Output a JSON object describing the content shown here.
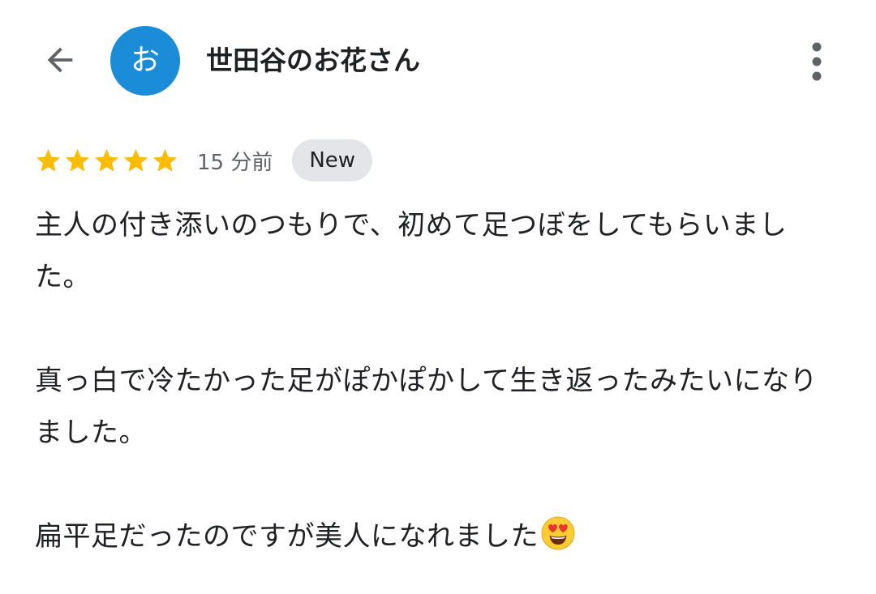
{
  "header": {
    "user_name": "世田谷のお花さん",
    "avatar_letter": "お",
    "avatar_color": "#1a8cd8",
    "back_icon": "arrow-back-icon",
    "more_icon": "more-vert-icon"
  },
  "review": {
    "rating": 5,
    "rating_max": 5,
    "star_color": "#fbbc04",
    "time_ago": "15 分前",
    "badge": "New",
    "paragraphs": [
      "主人の付き添いのつもりで、初めて足つぼをしてもらいました。",
      "真っ白で冷たかった足がぽかぽかして生き返ったみたいになりました。",
      "扁平足だったのですが美人になれました"
    ],
    "trailing_emoji": "smiling-face-with-heart-eyes-icon"
  }
}
